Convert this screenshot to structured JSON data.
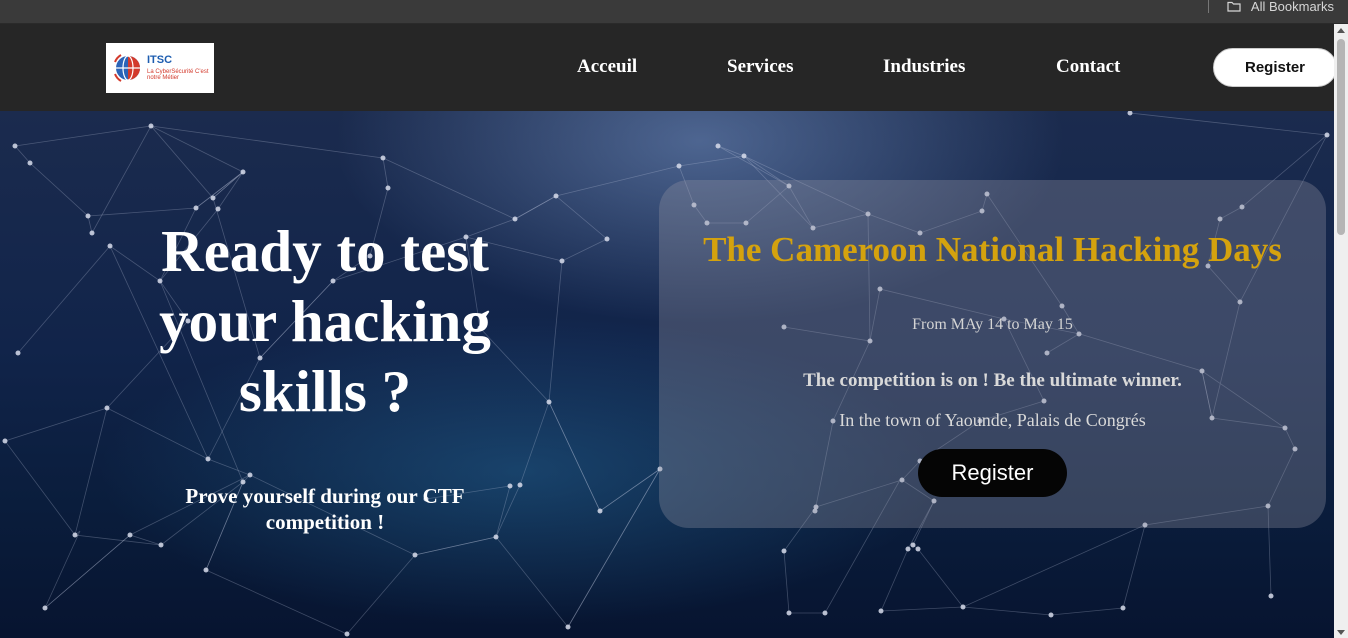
{
  "browser": {
    "bookmarks_label": "All Bookmarks",
    "bookmarks_icon": "folder-icon"
  },
  "header": {
    "logo": {
      "title": "ITSC",
      "subtitle": "La CyberSécurité C'est notre Métier",
      "icon": "globe-logo-icon"
    },
    "nav": {
      "acceuil": "Acceuil",
      "services": "Services",
      "industries": "Industries",
      "contact": "Contact"
    },
    "register_label": "Register"
  },
  "hero": {
    "heading": "Ready to test your hacking skills ?",
    "subheading": "Prove yourself during our CTF competition !"
  },
  "event": {
    "title": "The Cameroon National Hacking Days",
    "dates": "From MAy 14 to May 15",
    "tagline": "The competition is on ! Be the ultimate winner.",
    "location": "In the town of Yaounde, Palais de Congrés",
    "register_label": "Register"
  },
  "colors": {
    "navbar_bg": "#262626",
    "event_title": "#d4a20e",
    "register_btn_bg": "#050505"
  }
}
